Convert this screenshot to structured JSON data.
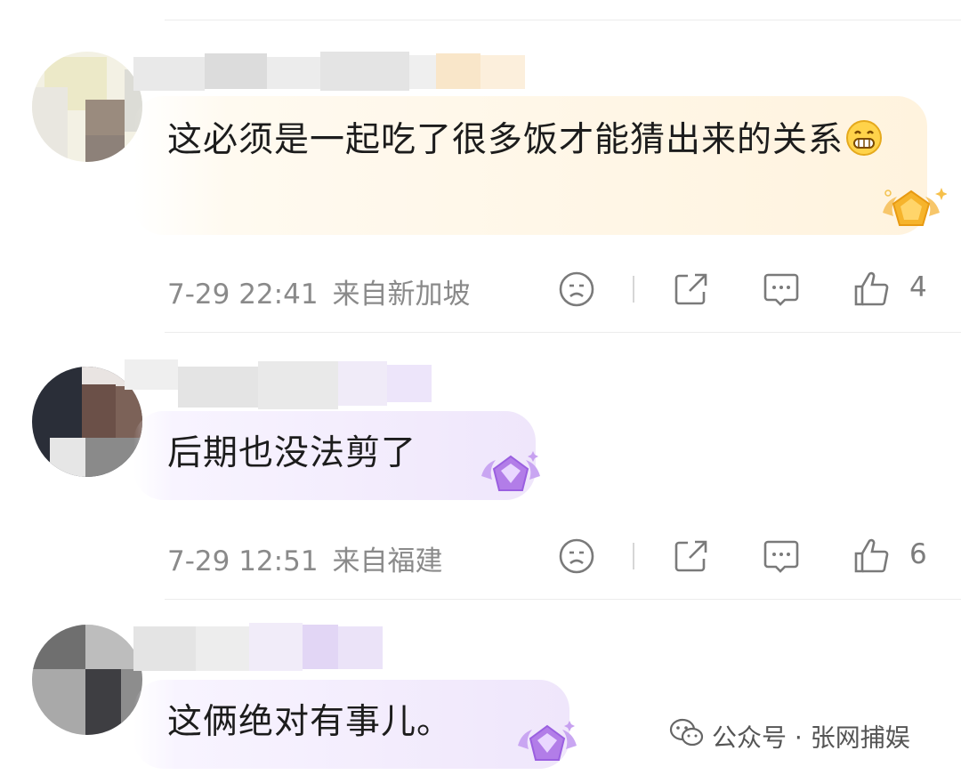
{
  "comments": [
    {
      "text": "这必须是一起吃了很多饭才能猜出来的关系",
      "emoji": "grin-emoji",
      "time": "7-29 22:41",
      "location": "来自新加坡",
      "like_count": "4",
      "badge": "gold-pentagon-badge"
    },
    {
      "text": "后期也没法剪了",
      "time": "7-29 12:51",
      "location": "来自福建",
      "like_count": "6",
      "badge": "purple-gem-badge"
    },
    {
      "text": "这俩绝对有事儿。",
      "badge": "purple-gem-badge"
    }
  ],
  "watermark": {
    "text": "公众号 · 张网捕娱",
    "icon": "wechat-icon"
  },
  "icons": [
    "sad-face-icon",
    "share-icon",
    "comment-icon",
    "thumbs-up-icon"
  ],
  "colors": {
    "gold_bubble": "#fff3de",
    "purple_bubble": "#efe6fb",
    "meta_text": "#8a8a8a",
    "icon_gray": "#7a7a7a"
  }
}
